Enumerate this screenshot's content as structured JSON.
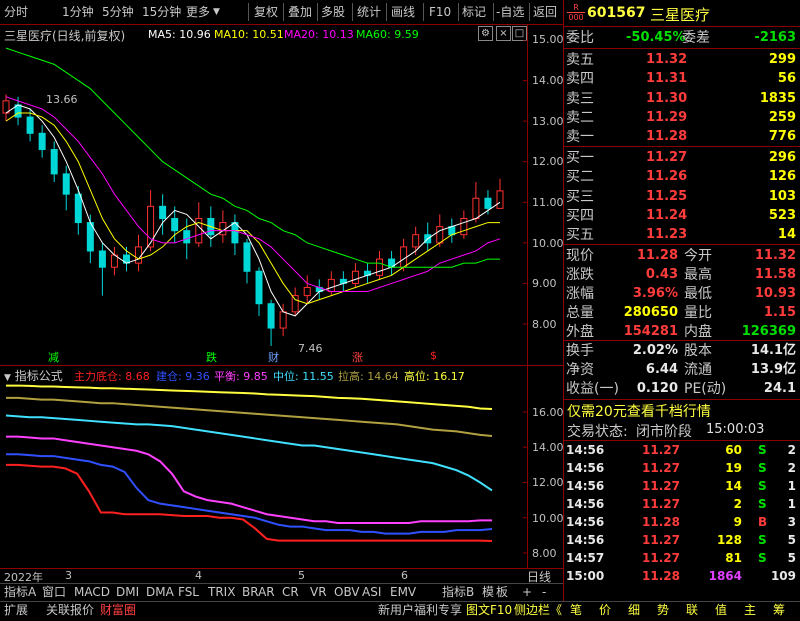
{
  "toolbar": {
    "left_tabs": [
      "分时",
      "1分钟",
      "5分钟",
      "15分钟",
      "更多"
    ],
    "right_buttons": [
      "复权",
      "叠加",
      "多股",
      "统计",
      "画线",
      "F10",
      "标记",
      "-自选",
      "返回"
    ]
  },
  "main_chart": {
    "header": "三星医疗(日线,前复权)",
    "ma": [
      {
        "label": "MA5: 10.96",
        "color": "#ffffff"
      },
      {
        "label": "MA10: 10.51",
        "color": "#ffff00"
      },
      {
        "label": "MA20: 10.13",
        "color": "#ff00ff"
      },
      {
        "label": "MA60: 9.59",
        "color": "#00ff00"
      }
    ],
    "y_labels": [
      "15.00",
      "14.00",
      "13.00",
      "12.00",
      "11.00",
      "10.00",
      "9.00",
      "8.00"
    ],
    "high_marker": "13.66",
    "low_marker": "7.46",
    "signals": [
      {
        "text": "减",
        "color": "#00ff00"
      },
      {
        "text": "跌",
        "color": "#00ff00"
      },
      {
        "text": "财",
        "color": "#6fa0ff"
      },
      {
        "text": "涨",
        "color": "#ff4040"
      },
      {
        "text": "$",
        "color": "#ff2020"
      }
    ]
  },
  "indicator": {
    "name": "指标公式",
    "items": [
      {
        "label": "主力底仓: 8.68",
        "color": "#ff2020"
      },
      {
        "label": "建仓: 9.36",
        "color": "#3050ff"
      },
      {
        "label": "平衡: 9.85",
        "color": "#ff40ff"
      },
      {
        "label": "中位: 11.55",
        "color": "#40e0ff"
      },
      {
        "label": "拉高: 14.64",
        "color": "#b0a040"
      },
      {
        "label": "高位: 16.17",
        "color": "#ffff40"
      }
    ],
    "y_labels": [
      "16.00",
      "14.00",
      "12.00",
      "10.00",
      "8.00"
    ]
  },
  "x_axis": {
    "labels": [
      "2022年",
      "3",
      "4",
      "5",
      "6"
    ],
    "period": "日线"
  },
  "bottom_tabs": [
    "指标A",
    "窗口",
    "MACD",
    "DMI",
    "DMA",
    "FSL",
    "TRIX",
    "BRAR",
    "CR",
    "VR",
    "OBV",
    "ASI",
    "EMV"
  ],
  "bottom_right": [
    "指标B",
    "模",
    "板",
    "+",
    "-"
  ],
  "status_bar": {
    "left": [
      "扩展",
      "关联报价",
      "财富圈"
    ],
    "right": [
      "新用户福利专享",
      "图文F10",
      "侧边栏《"
    ],
    "side": [
      "笔",
      "价",
      "细",
      "势",
      "联",
      "值",
      "主",
      "筹"
    ]
  },
  "stock": {
    "badge_top": "R",
    "badge_bottom": "000",
    "code": "601567",
    "name": "三星医疗",
    "weibi_label": "委比",
    "weibi": "-50.45%",
    "weicha_label": "委差",
    "weicha": "-2163",
    "sell": [
      {
        "label": "卖五",
        "price": "11.32",
        "vol": "299"
      },
      {
        "label": "卖四",
        "price": "11.31",
        "vol": "56"
      },
      {
        "label": "卖三",
        "price": "11.30",
        "vol": "1835"
      },
      {
        "label": "卖二",
        "price": "11.29",
        "vol": "259"
      },
      {
        "label": "卖一",
        "price": "11.28",
        "vol": "776"
      }
    ],
    "buy": [
      {
        "label": "买一",
        "price": "11.27",
        "vol": "296"
      },
      {
        "label": "买二",
        "price": "11.26",
        "vol": "126"
      },
      {
        "label": "买三",
        "price": "11.25",
        "vol": "103"
      },
      {
        "label": "买四",
        "price": "11.24",
        "vol": "523"
      },
      {
        "label": "买五",
        "price": "11.23",
        "vol": "14"
      }
    ],
    "stats": [
      {
        "l1": "现价",
        "v1": "11.28",
        "c1": "red",
        "l2": "今开",
        "v2": "11.32",
        "c2": "red"
      },
      {
        "l1": "涨跌",
        "v1": "0.43",
        "c1": "red",
        "l2": "最高",
        "v2": "11.58",
        "c2": "red"
      },
      {
        "l1": "涨幅",
        "v1": "3.96%",
        "c1": "red",
        "l2": "最低",
        "v2": "10.93",
        "c2": "red"
      },
      {
        "l1": "总量",
        "v1": "280650",
        "c1": "yellow",
        "l2": "量比",
        "v2": "1.15",
        "c2": "red"
      },
      {
        "l1": "外盘",
        "v1": "154281",
        "c1": "red",
        "l2": "内盘",
        "v2": "126369",
        "c2": "green"
      }
    ],
    "stats2": [
      {
        "l1": "换手",
        "v1": "2.02%",
        "l2": "股本",
        "v2": "14.1亿"
      },
      {
        "l1": "净资",
        "v1": "6.44",
        "l2": "流通",
        "v2": "13.9亿"
      },
      {
        "l1": "收益(一)",
        "v1": "0.120",
        "l2": "PE(动)",
        "v2": "24.1"
      }
    ],
    "promo": "仅需20元查看千档行情",
    "trade_status_label": "交易状态:",
    "trade_status": "闭市阶段",
    "trade_time": "15:00:03",
    "ticks": [
      {
        "time": "14:56",
        "price": "11.27",
        "vol": "60",
        "side": "S",
        "n": "2"
      },
      {
        "time": "14:56",
        "price": "11.27",
        "vol": "19",
        "side": "S",
        "n": "2"
      },
      {
        "time": "14:56",
        "price": "11.27",
        "vol": "14",
        "side": "S",
        "n": "1"
      },
      {
        "time": "14:56",
        "price": "11.27",
        "vol": "2",
        "side": "S",
        "n": "1"
      },
      {
        "time": "14:56",
        "price": "11.28",
        "vol": "9",
        "side": "B",
        "n": "3"
      },
      {
        "time": "14:56",
        "price": "11.27",
        "vol": "128",
        "side": "S",
        "n": "5"
      },
      {
        "time": "14:57",
        "price": "11.27",
        "vol": "81",
        "side": "S",
        "n": "5"
      },
      {
        "time": "15:00",
        "price": "11.28",
        "vol": "1864",
        "side": "",
        "n": "109"
      }
    ]
  },
  "chart_data": [
    {
      "type": "line",
      "ylim": [
        7.5,
        15.3
      ],
      "series": [
        {
          "name": "MA5",
          "color": "#ffffff",
          "values": [
            13.2,
            13.4,
            13.3,
            13.0,
            12.6,
            12.0,
            11.3,
            10.5,
            10.0,
            9.7,
            9.5,
            9.6,
            10.0,
            10.5,
            10.8,
            10.7,
            10.4,
            10.1,
            10.3,
            10.5,
            10.2,
            9.6,
            8.8,
            8.3,
            8.2,
            8.5,
            8.8,
            8.9,
            9.0,
            9.1,
            9.2,
            9.3,
            9.4,
            9.6,
            9.8,
            10.1,
            10.3,
            10.4,
            10.5,
            10.6,
            10.8,
            11.0
          ]
        },
        {
          "name": "MA10",
          "color": "#ffff00",
          "values": [
            13.0,
            13.2,
            13.2,
            13.1,
            12.9,
            12.5,
            12.0,
            11.3,
            10.6,
            10.1,
            9.8,
            9.6,
            9.7,
            9.9,
            10.2,
            10.4,
            10.5,
            10.4,
            10.3,
            10.3,
            10.3,
            10.0,
            9.5,
            9.0,
            8.6,
            8.5,
            8.6,
            8.7,
            8.8,
            8.9,
            9.0,
            9.1,
            9.2,
            9.4,
            9.6,
            9.8,
            10.0,
            10.2,
            10.3,
            10.4,
            10.5,
            10.5
          ]
        },
        {
          "name": "MA20",
          "color": "#ff00ff",
          "values": [
            13.6,
            13.5,
            13.4,
            13.3,
            13.1,
            12.8,
            12.5,
            12.1,
            11.7,
            11.2,
            10.8,
            10.4,
            10.1,
            10.0,
            10.0,
            10.1,
            10.2,
            10.3,
            10.3,
            10.3,
            10.2,
            10.1,
            9.9,
            9.6,
            9.3,
            9.0,
            8.9,
            8.8,
            8.8,
            8.8,
            8.8,
            8.9,
            9.0,
            9.1,
            9.2,
            9.3,
            9.5,
            9.6,
            9.7,
            9.8,
            10.0,
            10.1
          ]
        },
        {
          "name": "MA60",
          "color": "#00ff00",
          "values": [
            14.8,
            14.7,
            14.6,
            14.5,
            14.4,
            14.2,
            14.0,
            13.8,
            13.5,
            13.2,
            12.9,
            12.6,
            12.3,
            12.0,
            11.8,
            11.6,
            11.4,
            11.2,
            11.1,
            10.9,
            10.8,
            10.6,
            10.5,
            10.3,
            10.2,
            10.0,
            9.9,
            9.8,
            9.7,
            9.6,
            9.5,
            9.5,
            9.4,
            9.4,
            9.4,
            9.4,
            9.4,
            9.4,
            9.5,
            9.5,
            9.6,
            9.6
          ]
        }
      ],
      "candles": [
        {
          "o": 13.2,
          "c": 13.5,
          "h": 13.66,
          "l": 13.0
        },
        {
          "o": 13.4,
          "c": 13.1,
          "h": 13.6,
          "l": 12.9
        },
        {
          "o": 13.1,
          "c": 12.7,
          "h": 13.3,
          "l": 12.5
        },
        {
          "o": 12.7,
          "c": 12.3,
          "h": 12.9,
          "l": 12.1
        },
        {
          "o": 12.3,
          "c": 11.7,
          "h": 12.5,
          "l": 11.5
        },
        {
          "o": 11.7,
          "c": 11.2,
          "h": 11.9,
          "l": 10.8
        },
        {
          "o": 11.2,
          "c": 10.5,
          "h": 11.4,
          "l": 10.2
        },
        {
          "o": 10.5,
          "c": 9.8,
          "h": 10.7,
          "l": 9.5
        },
        {
          "o": 9.8,
          "c": 9.4,
          "h": 10.0,
          "l": 8.7
        },
        {
          "o": 9.4,
          "c": 9.7,
          "h": 9.9,
          "l": 9.2
        },
        {
          "o": 9.7,
          "c": 9.5,
          "h": 9.9,
          "l": 9.3
        },
        {
          "o": 9.5,
          "c": 9.9,
          "h": 10.2,
          "l": 9.3
        },
        {
          "o": 9.9,
          "c": 10.9,
          "h": 11.3,
          "l": 9.8
        },
        {
          "o": 10.9,
          "c": 10.6,
          "h": 11.2,
          "l": 10.2
        },
        {
          "o": 10.6,
          "c": 10.3,
          "h": 10.9,
          "l": 10.0
        },
        {
          "o": 10.3,
          "c": 10.0,
          "h": 10.6,
          "l": 9.6
        },
        {
          "o": 10.0,
          "c": 10.6,
          "h": 11.0,
          "l": 9.9
        },
        {
          "o": 10.6,
          "c": 10.2,
          "h": 10.9,
          "l": 9.9
        },
        {
          "o": 10.2,
          "c": 10.5,
          "h": 10.8,
          "l": 10.0
        },
        {
          "o": 10.5,
          "c": 10.0,
          "h": 10.7,
          "l": 9.7
        },
        {
          "o": 10.0,
          "c": 9.3,
          "h": 10.1,
          "l": 9.0
        },
        {
          "o": 9.3,
          "c": 8.5,
          "h": 9.4,
          "l": 8.2
        },
        {
          "o": 8.5,
          "c": 7.9,
          "h": 8.6,
          "l": 7.46
        },
        {
          "o": 7.9,
          "c": 8.3,
          "h": 8.5,
          "l": 7.7
        },
        {
          "o": 8.3,
          "c": 8.7,
          "h": 8.9,
          "l": 8.2
        },
        {
          "o": 8.7,
          "c": 8.9,
          "h": 9.2,
          "l": 8.5
        },
        {
          "o": 8.9,
          "c": 8.8,
          "h": 9.1,
          "l": 8.6
        },
        {
          "o": 8.8,
          "c": 9.1,
          "h": 9.3,
          "l": 8.7
        },
        {
          "o": 9.1,
          "c": 9.0,
          "h": 9.3,
          "l": 8.8
        },
        {
          "o": 9.0,
          "c": 9.3,
          "h": 9.5,
          "l": 8.9
        },
        {
          "o": 9.3,
          "c": 9.2,
          "h": 9.5,
          "l": 9.0
        },
        {
          "o": 9.2,
          "c": 9.6,
          "h": 9.8,
          "l": 9.1
        },
        {
          "o": 9.6,
          "c": 9.4,
          "h": 9.8,
          "l": 9.2
        },
        {
          "o": 9.4,
          "c": 9.9,
          "h": 10.1,
          "l": 9.3
        },
        {
          "o": 9.9,
          "c": 10.2,
          "h": 10.4,
          "l": 9.7
        },
        {
          "o": 10.2,
          "c": 10.0,
          "h": 10.5,
          "l": 9.8
        },
        {
          "o": 10.0,
          "c": 10.4,
          "h": 10.7,
          "l": 9.9
        },
        {
          "o": 10.4,
          "c": 10.2,
          "h": 10.6,
          "l": 10.0
        },
        {
          "o": 10.2,
          "c": 10.6,
          "h": 10.8,
          "l": 10.1
        },
        {
          "o": 10.6,
          "c": 11.1,
          "h": 11.5,
          "l": 10.5
        },
        {
          "o": 11.1,
          "c": 10.85,
          "h": 11.3,
          "l": 10.7
        },
        {
          "o": 10.85,
          "c": 11.28,
          "h": 11.58,
          "l": 10.93
        }
      ]
    },
    {
      "type": "line",
      "ylim": [
        7.7,
        17.6
      ],
      "series": [
        {
          "name": "主力底仓",
          "color": "#ff2020",
          "values": [
            13.0,
            13.0,
            12.95,
            12.9,
            12.9,
            12.8,
            12.5,
            11.5,
            10.3,
            10.3,
            10.2,
            10.2,
            10.2,
            10.2,
            10.15,
            10.1,
            10.1,
            10.1,
            10.0,
            10.0,
            9.9,
            9.4,
            8.8,
            8.7,
            8.7,
            8.7,
            8.7,
            8.7,
            8.7,
            8.7,
            8.7,
            8.7,
            8.7,
            8.7,
            8.7,
            8.7,
            8.7,
            8.7,
            8.7,
            8.7,
            8.7,
            8.68
          ]
        },
        {
          "name": "建仓",
          "color": "#3050ff",
          "values": [
            13.6,
            13.6,
            13.55,
            13.5,
            13.5,
            13.4,
            13.3,
            13.2,
            13.0,
            12.9,
            12.6,
            11.7,
            11.0,
            10.8,
            10.7,
            10.6,
            10.5,
            10.4,
            10.3,
            10.2,
            10.1,
            10.0,
            9.8,
            9.6,
            9.5,
            9.5,
            9.4,
            9.3,
            9.3,
            9.3,
            9.2,
            9.2,
            9.1,
            9.1,
            9.1,
            9.2,
            9.2,
            9.2,
            9.3,
            9.3,
            9.3,
            9.36
          ]
        },
        {
          "name": "平衡",
          "color": "#ff40ff",
          "values": [
            14.6,
            14.6,
            14.55,
            14.5,
            14.5,
            14.4,
            14.3,
            14.2,
            14.1,
            14.0,
            13.9,
            13.8,
            13.6,
            13.2,
            12.5,
            11.5,
            11.2,
            11.0,
            10.9,
            10.8,
            10.6,
            10.4,
            10.2,
            10.1,
            10.0,
            9.9,
            9.8,
            9.8,
            9.7,
            9.7,
            9.7,
            9.7,
            9.7,
            9.7,
            9.7,
            9.8,
            9.8,
            9.8,
            9.8,
            9.8,
            9.85,
            9.85
          ]
        },
        {
          "name": "中位",
          "color": "#40e0ff",
          "values": [
            15.8,
            15.75,
            15.7,
            15.7,
            15.65,
            15.6,
            15.55,
            15.5,
            15.45,
            15.4,
            15.35,
            15.3,
            15.3,
            15.25,
            15.2,
            15.1,
            15.0,
            14.9,
            14.8,
            14.7,
            14.6,
            14.5,
            14.4,
            14.3,
            14.2,
            14.1,
            14.1,
            14.0,
            13.9,
            13.8,
            13.7,
            13.6,
            13.5,
            13.4,
            13.3,
            13.2,
            13.1,
            12.9,
            12.7,
            12.4,
            12.0,
            11.55
          ]
        },
        {
          "name": "拉高",
          "color": "#b0a040",
          "values": [
            16.8,
            16.8,
            16.75,
            16.7,
            16.7,
            16.65,
            16.6,
            16.55,
            16.5,
            16.5,
            16.45,
            16.4,
            16.35,
            16.3,
            16.25,
            16.2,
            16.15,
            16.1,
            16.05,
            16.0,
            15.95,
            15.9,
            15.85,
            15.8,
            15.75,
            15.7,
            15.65,
            15.6,
            15.55,
            15.5,
            15.45,
            15.4,
            15.35,
            15.3,
            15.2,
            15.1,
            15.0,
            14.95,
            14.9,
            14.8,
            14.7,
            14.64
          ]
        },
        {
          "name": "高位",
          "color": "#ffff40",
          "values": [
            17.5,
            17.5,
            17.48,
            17.45,
            17.45,
            17.42,
            17.4,
            17.38,
            17.35,
            17.35,
            17.32,
            17.3,
            17.28,
            17.25,
            17.22,
            17.2,
            17.18,
            17.15,
            17.12,
            17.1,
            17.08,
            17.05,
            17.0,
            16.98,
            16.95,
            16.92,
            16.9,
            16.85,
            16.8,
            16.78,
            16.75,
            16.7,
            16.65,
            16.6,
            16.55,
            16.5,
            16.45,
            16.4,
            16.35,
            16.3,
            16.2,
            16.17
          ]
        }
      ]
    }
  ]
}
